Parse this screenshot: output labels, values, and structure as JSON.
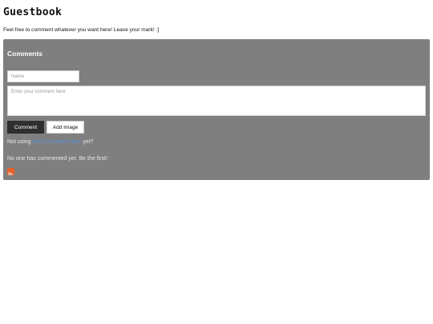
{
  "page": {
    "title": "Guestbook",
    "intro": "Feel free to comment whatever you want here! Leave your mark! :]"
  },
  "comments": {
    "heading": "Comments",
    "name_placeholder": "Name",
    "comment_placeholder": "Enter your comment here",
    "comment_button": "Comment",
    "add_image_button": "Add Image",
    "promo_prefix": "Not using",
    "promo_link": "Html Comment Box",
    "promo_suffix": "yet?",
    "empty_message": "No one has commented yet. Be the first!",
    "rss_icon": "rss-icon"
  },
  "colors": {
    "panel_background": "#7f7f7f",
    "comment_button": "#2f2f2f",
    "link": "#5b8fd6",
    "rss": "#e8632b"
  }
}
